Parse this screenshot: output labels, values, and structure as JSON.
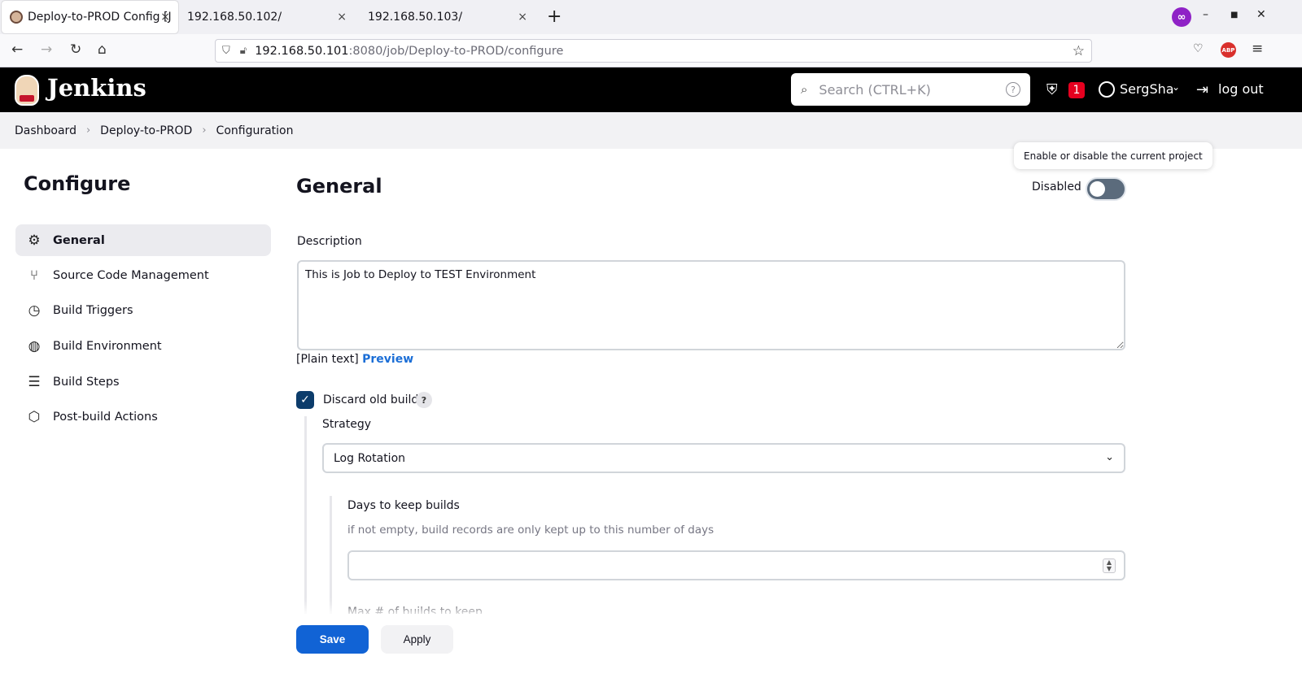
{
  "browser": {
    "tabs": [
      {
        "title": "Deploy-to-PROD Config [J",
        "active": true
      },
      {
        "title": "192.168.50.102/",
        "active": false
      },
      {
        "title": "192.168.50.103/",
        "active": false
      }
    ],
    "new_tab": "+",
    "close_glyph": "×",
    "url_host": "192.168.50.101",
    "url_rest": ":8080/job/Deploy-to-PROD/configure",
    "abp_label": "ABP"
  },
  "header": {
    "app_name": "Jenkins",
    "search_placeholder": "Search (CTRL+K)",
    "security_count": "1",
    "username": "SergSha",
    "logout": "log out"
  },
  "breadcrumb": [
    "Dashboard",
    "Deploy-to-PROD",
    "Configuration"
  ],
  "sidebar": {
    "title": "Configure",
    "items": [
      {
        "label": "General",
        "icon": "gear-icon",
        "selected": true
      },
      {
        "label": "Source Code Management",
        "icon": "branch-icon",
        "selected": false
      },
      {
        "label": "Build Triggers",
        "icon": "clock-icon",
        "selected": false
      },
      {
        "label": "Build Environment",
        "icon": "globe-icon",
        "selected": false
      },
      {
        "label": "Build Steps",
        "icon": "list-icon",
        "selected": false
      },
      {
        "label": "Post-build Actions",
        "icon": "package-icon",
        "selected": false
      }
    ]
  },
  "main": {
    "title": "General",
    "tooltip": "Enable or disable the current project",
    "toggle_label": "Disabled",
    "description_label": "Description",
    "description_value": "This is Job to Deploy to TEST Environment",
    "plain_text": "[Plain text]",
    "preview": "Preview",
    "discard_label": "Discard old builds",
    "discard_checked": true,
    "help": "?",
    "strategy_label": "Strategy",
    "strategy_value": "Log Rotation",
    "days_label": "Days to keep builds",
    "days_hint": "if not empty, build records are only kept up to this number of days",
    "days_value": "",
    "max_builds_label": "Max # of builds to keep"
  },
  "actions": {
    "save": "Save",
    "apply": "Apply"
  }
}
